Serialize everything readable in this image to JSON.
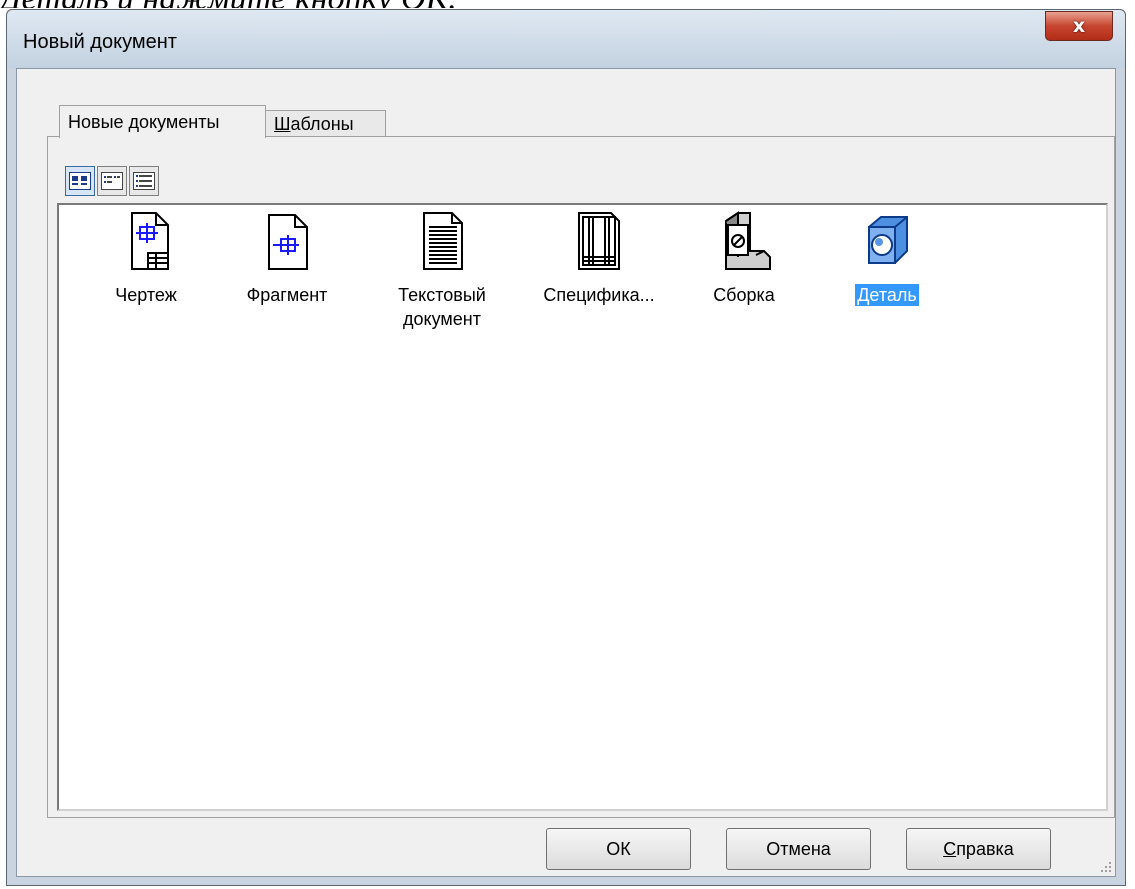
{
  "doc_caption": "Деталь и нажмите кнопку ОК.",
  "window": {
    "title": "Новый документ",
    "close_label": "x"
  },
  "tabs": [
    {
      "label": "Новые документы",
      "active": true
    },
    {
      "label_underlined": "Ш",
      "label_rest": "аблоны",
      "active": false
    }
  ],
  "view_buttons": [
    {
      "icon": "large-icons-view-icon",
      "active": true
    },
    {
      "icon": "list-view-icon",
      "active": false
    },
    {
      "icon": "details-view-icon",
      "active": false
    }
  ],
  "items": [
    {
      "label": "Чертеж",
      "icon": "drawing-icon",
      "selected": false
    },
    {
      "label": "Фрагмент",
      "icon": "fragment-icon",
      "selected": false
    },
    {
      "label": "Текстовый документ",
      "icon": "text-document-icon",
      "selected": false
    },
    {
      "label": "Специфика...",
      "icon": "specification-icon",
      "selected": false
    },
    {
      "label": "Сборка",
      "icon": "assembly-icon",
      "selected": false
    },
    {
      "label": "Деталь",
      "icon": "part-icon",
      "selected": true
    }
  ],
  "buttons": {
    "ok": "ОК",
    "cancel": "Отмена",
    "help_underlined": "С",
    "help_rest": "правка"
  },
  "colors": {
    "selection": "#3399ff",
    "close_button": "#c7452f",
    "icon_blue": "#1a1aff"
  }
}
